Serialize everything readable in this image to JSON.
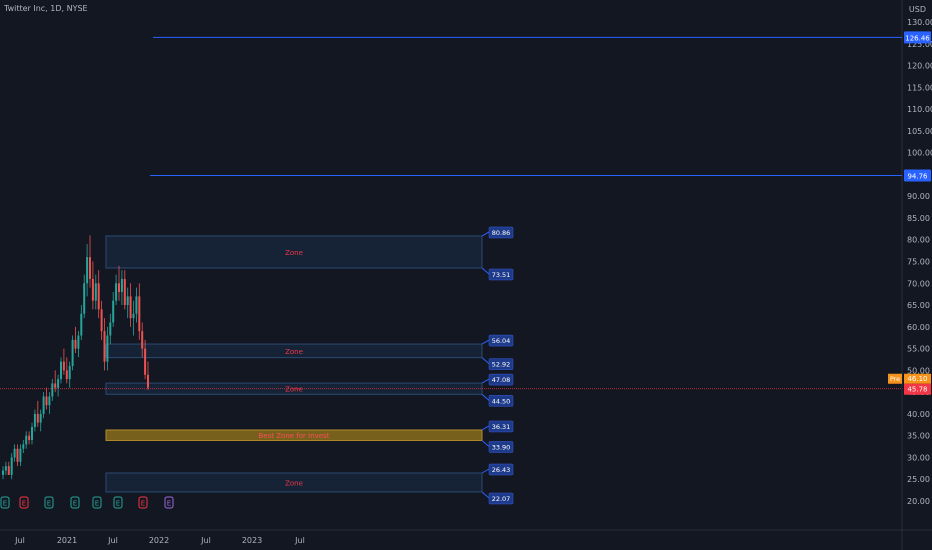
{
  "header": {
    "symbol": "Twitter Inc, 1D, NYSE",
    "currency": "USD"
  },
  "colors": {
    "background": "#131722",
    "axis_text": "#b2b5be",
    "up": "#26a69a",
    "down": "#ef5350",
    "level_line": "#2962ff",
    "zone_fill": "#1e3a5f",
    "best_zone_fill": "#8a6d1a",
    "zone_text": "#f23645",
    "price_tag": "#1e3a8a",
    "pre_tag": "#f7931a",
    "last_tag": "#f23645"
  },
  "chart_data": {
    "type": "candlestick",
    "title": "Twitter Inc, 1D, NYSE",
    "yaxis": {
      "ticks": [
        "130.00",
        "125.00",
        "120.00",
        "115.00",
        "110.00",
        "105.00",
        "100.00",
        "95.00",
        "90.00",
        "85.00",
        "80.00",
        "75.00",
        "70.00",
        "65.00",
        "60.00",
        "55.00",
        "50.00",
        "45.00",
        "40.00",
        "35.00",
        "30.00",
        "25.00",
        "20.00"
      ],
      "range": [
        18,
        132
      ]
    },
    "xaxis": {
      "ticks": [
        "Jul",
        "2021",
        "Jul",
        "2022",
        "Jul",
        "2023",
        "Jul"
      ]
    },
    "horizontal_levels": [
      {
        "label": "126.46",
        "value": 126.46
      },
      {
        "label": "94.76",
        "value": 94.76
      }
    ],
    "zones": [
      {
        "name": "Zone",
        "top": 80.86,
        "bottom": 73.51,
        "top_label": "80.86",
        "bottom_label": "73.51"
      },
      {
        "name": "Zone",
        "top": 56.04,
        "bottom": 52.92,
        "top_label": "56.04",
        "bottom_label": "52.92"
      },
      {
        "name": "Zone",
        "top": 47.08,
        "bottom": 44.5,
        "top_label": "47.08",
        "bottom_label": "44.50"
      },
      {
        "name": "Best Zone for Invest",
        "top": 36.31,
        "bottom": 33.9,
        "top_label": "36.31",
        "bottom_label": "33.90",
        "best": true
      },
      {
        "name": "Zone",
        "top": 26.43,
        "bottom": 22.07,
        "top_label": "26.43",
        "bottom_label": "22.07"
      }
    ],
    "price_labels": {
      "pre_tag": "Pre",
      "pre_price": "46.10",
      "last_price": "45.78",
      "last_value": 45.78
    },
    "event_markers": [
      "E",
      "E",
      "E",
      "E",
      "E",
      "E",
      "E",
      "E"
    ],
    "candles": [
      [
        26,
        28,
        25,
        27
      ],
      [
        27,
        29,
        26,
        28
      ],
      [
        28,
        29,
        26,
        26
      ],
      [
        26,
        31,
        25,
        30
      ],
      [
        30,
        33,
        29,
        32
      ],
      [
        32,
        33,
        28,
        29
      ],
      [
        29,
        33,
        28,
        32
      ],
      [
        32,
        34,
        31,
        33
      ],
      [
        33,
        36,
        32,
        35
      ],
      [
        35,
        36,
        33,
        34
      ],
      [
        34,
        38,
        33,
        37
      ],
      [
        37,
        41,
        36,
        40
      ],
      [
        40,
        43,
        37,
        38
      ],
      [
        38,
        41,
        36,
        40
      ],
      [
        40,
        45,
        39,
        44
      ],
      [
        44,
        46,
        41,
        42
      ],
      [
        42,
        45,
        40,
        44
      ],
      [
        44,
        48,
        43,
        47
      ],
      [
        47,
        50,
        45,
        46
      ],
      [
        46,
        49,
        44,
        48
      ],
      [
        48,
        53,
        47,
        52
      ],
      [
        52,
        55,
        49,
        50
      ],
      [
        50,
        53,
        47,
        48
      ],
      [
        48,
        52,
        46,
        51
      ],
      [
        51,
        58,
        50,
        57
      ],
      [
        57,
        60,
        54,
        55
      ],
      [
        55,
        59,
        53,
        58
      ],
      [
        58,
        65,
        57,
        63
      ],
      [
        63,
        72,
        62,
        70
      ],
      [
        70,
        79,
        67,
        76
      ],
      [
        76,
        81,
        69,
        71
      ],
      [
        71,
        75,
        64,
        66
      ],
      [
        66,
        72,
        64,
        70
      ],
      [
        70,
        73,
        62,
        64
      ],
      [
        64,
        66,
        57,
        59
      ],
      [
        59,
        62,
        50,
        52
      ],
      [
        52,
        60,
        50,
        58
      ],
      [
        58,
        63,
        56,
        61
      ],
      [
        61,
        68,
        60,
        66
      ],
      [
        66,
        72,
        65,
        70
      ],
      [
        70,
        74,
        66,
        68
      ],
      [
        68,
        73,
        65,
        71
      ],
      [
        71,
        73,
        64,
        65
      ],
      [
        65,
        69,
        62,
        67
      ],
      [
        67,
        70,
        60,
        62
      ],
      [
        62,
        66,
        58,
        63
      ],
      [
        63,
        69,
        61,
        67
      ],
      [
        67,
        70,
        57,
        59
      ],
      [
        59,
        61,
        53,
        55
      ],
      [
        55,
        57,
        48,
        49
      ],
      [
        49,
        52,
        45.5,
        46
      ]
    ]
  }
}
